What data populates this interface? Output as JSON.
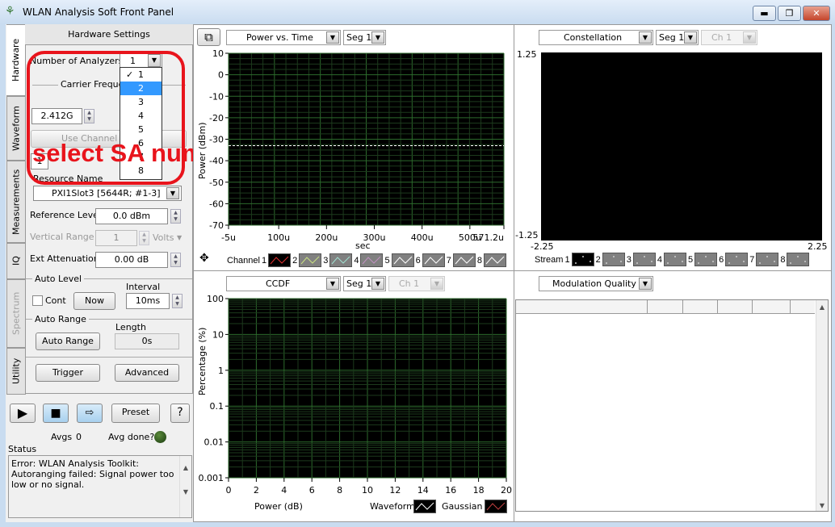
{
  "window": {
    "title": "WLAN Analysis Soft Front Panel",
    "minimize": "▬",
    "restore": "❐",
    "close": "✕"
  },
  "tabs": [
    {
      "label": "Hardware",
      "selected": true
    },
    {
      "label": "Waveform"
    },
    {
      "label": "Measurements"
    },
    {
      "label": "IQ"
    },
    {
      "label": "Spectrum",
      "disabled": true
    },
    {
      "label": "Utility"
    }
  ],
  "hardware": {
    "header": "Hardware Settings",
    "num_analyzers_label": "Number of Analyzers",
    "num_analyzers_value": "1",
    "num_analyzers_options": [
      "1",
      "2",
      "3",
      "4",
      "5",
      "6",
      "7",
      "8"
    ],
    "checked_option": "1",
    "highlighted_option": "2",
    "carrier_freq_label": "Carrier Frequency",
    "carrier_freq_value": "2.412G",
    "use_channel_label": "Use Channel Number",
    "channel_field": "1",
    "resource_name_label": "Resource Name",
    "resource_name_value": "PXI1Slot3 [5644R; #1-3]",
    "ref_level_label": "Reference Level",
    "ref_level_value": "0.0 dBm",
    "vertical_range_label": "Vertical Range",
    "vertical_range_value": "1",
    "vertical_range_unit": "Volts",
    "ext_atten_label": "Ext Attenuation",
    "ext_atten_value": "0.00 dB",
    "auto_level_label": "Auto Level",
    "interval_label": "Interval",
    "cont_label": "Cont",
    "now_label": "Now",
    "interval_value": "10ms",
    "auto_range_label": "Auto Range",
    "length_label": "Length",
    "auto_range_button": "Auto Range",
    "length_value": "0s",
    "trigger_button": "Trigger",
    "advanced_button": "Advanced"
  },
  "annotation": {
    "text": "select SA numbers",
    "color": "#e8141c"
  },
  "controls": {
    "preset": "Preset",
    "help": "?",
    "avgs_label": "Avgs",
    "avgs_value": "0",
    "avg_done_label": "Avg done?",
    "status_label": "Status",
    "status_text": "Error:  WLAN Analysis Toolkit: Autoranging failed: Signal power too low or no signal."
  },
  "pvt": {
    "view": "Power vs. Time",
    "seg": "Seg 1",
    "ylabel": "Power (dBm)",
    "xlabel": "sec",
    "yticks": [
      "10",
      "0",
      "-10",
      "-20",
      "-30",
      "-40",
      "-50",
      "-60",
      "-70"
    ],
    "xticks": [
      "-5u",
      "100u",
      "200u",
      "300u",
      "400u",
      "500u",
      "571.2u"
    ],
    "legend_label": "Channel",
    "channels": [
      "1",
      "2",
      "3",
      "4",
      "5",
      "6",
      "7",
      "8"
    ],
    "channel_colors": [
      "#e03030",
      "#c8e080",
      "#a0e0d0",
      "#c090c0",
      "#ffffff",
      "#ffffff",
      "#ffffff",
      "#ffffff"
    ],
    "reference_line_dbm": -33
  },
  "constellation": {
    "view": "Constellation",
    "seg": "Seg 1",
    "ch": "Ch 1",
    "ymax": "1.25",
    "ymin": "-1.25",
    "xmin": "-2.25",
    "xmax": "2.25",
    "legend_label": "Stream",
    "streams": [
      "1",
      "2",
      "3",
      "4",
      "5",
      "6",
      "7",
      "8"
    ]
  },
  "ccdf": {
    "view": "CCDF",
    "seg": "Seg 1",
    "ch": "Ch 1",
    "ylabel": "Percentage (%)",
    "xlabel": "Power (dB)",
    "yticks": [
      "100",
      "10",
      "1",
      "0.1",
      "0.01",
      "0.001"
    ],
    "xticks": [
      "0",
      "2",
      "4",
      "6",
      "8",
      "10",
      "12",
      "14",
      "16",
      "18",
      "20"
    ],
    "legend": [
      {
        "name": "Waveform",
        "color": "#ffffff"
      },
      {
        "name": "Gaussian",
        "color": "#c04040"
      }
    ]
  },
  "modq": {
    "view": "Modulation Quality"
  }
}
